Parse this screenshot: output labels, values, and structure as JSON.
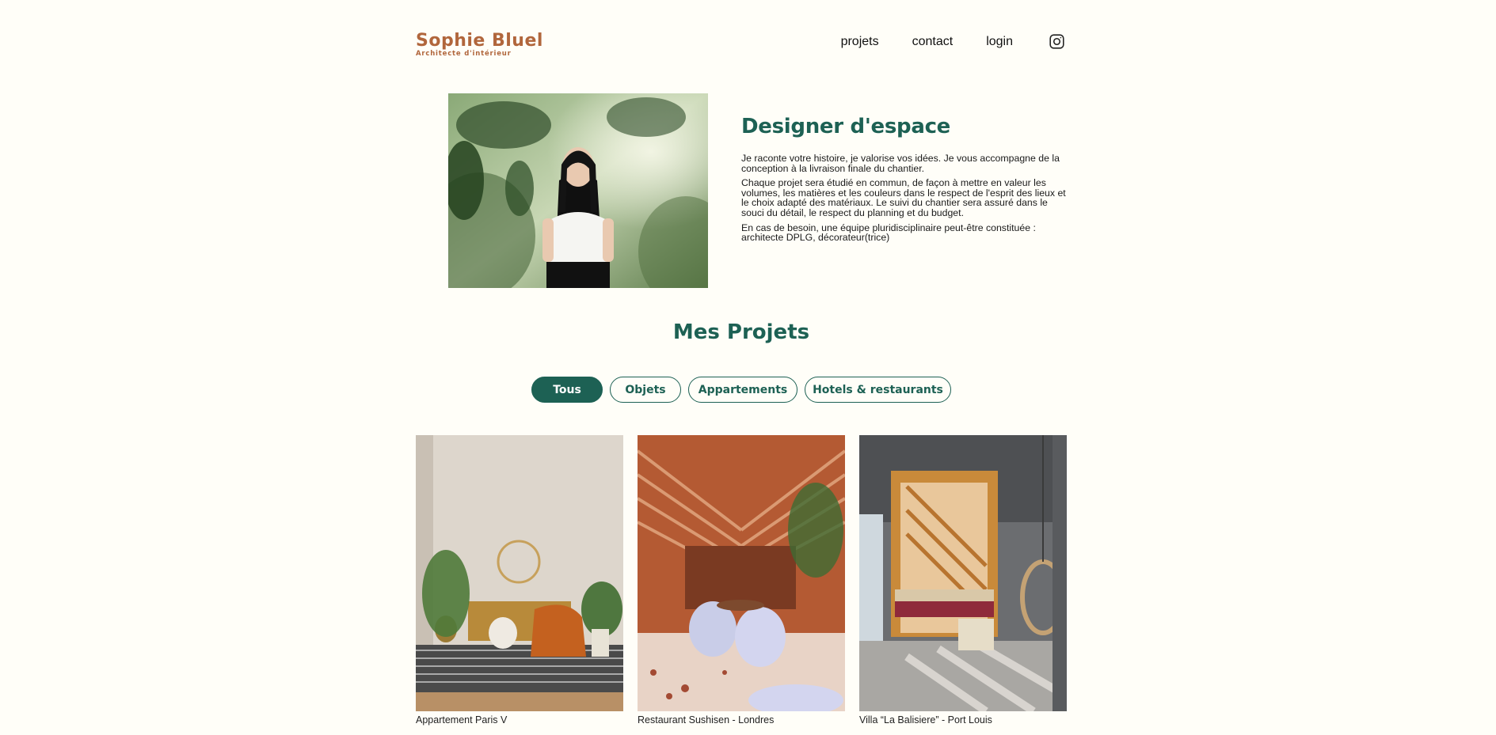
{
  "header": {
    "logo_title": "Sophie Bluel",
    "logo_subtitle": "Architecte d'intérieur",
    "nav": {
      "projets": "projets",
      "contact": "contact",
      "login": "login"
    },
    "instagram_icon": "instagram-icon"
  },
  "intro": {
    "photo": "portrait-photo",
    "title": "Designer d'espace",
    "paragraphs": [
      "Je raconte votre histoire, je valorise vos idées. Je vous accompagne de la conception à la livraison finale du chantier.",
      "Chaque projet sera étudié en commun, de façon à mettre en valeur les volumes, les matières et les couleurs dans le respect de l'esprit des lieux et le choix adapté des matériaux. Le suivi du chantier sera assuré dans le souci du détail, le respect du planning et du budget.",
      "En cas de besoin, une équipe pluridisciplinaire peut-être constituée : architecte DPLG, décorateur(trice)"
    ]
  },
  "projects": {
    "title": "Mes Projets",
    "filters": [
      "Tous",
      "Objets",
      "Appartements",
      "Hotels & restaurants"
    ],
    "active_filter": "Tous",
    "items": [
      {
        "caption": "Appartement Paris V"
      },
      {
        "caption": "Restaurant Sushisen - Londres"
      },
      {
        "caption": "Villa “La Balisiere” - Port Louis"
      }
    ]
  },
  "colors": {
    "background": "#fffef8",
    "brand": "#b1663c",
    "accent": "#1d6154"
  }
}
